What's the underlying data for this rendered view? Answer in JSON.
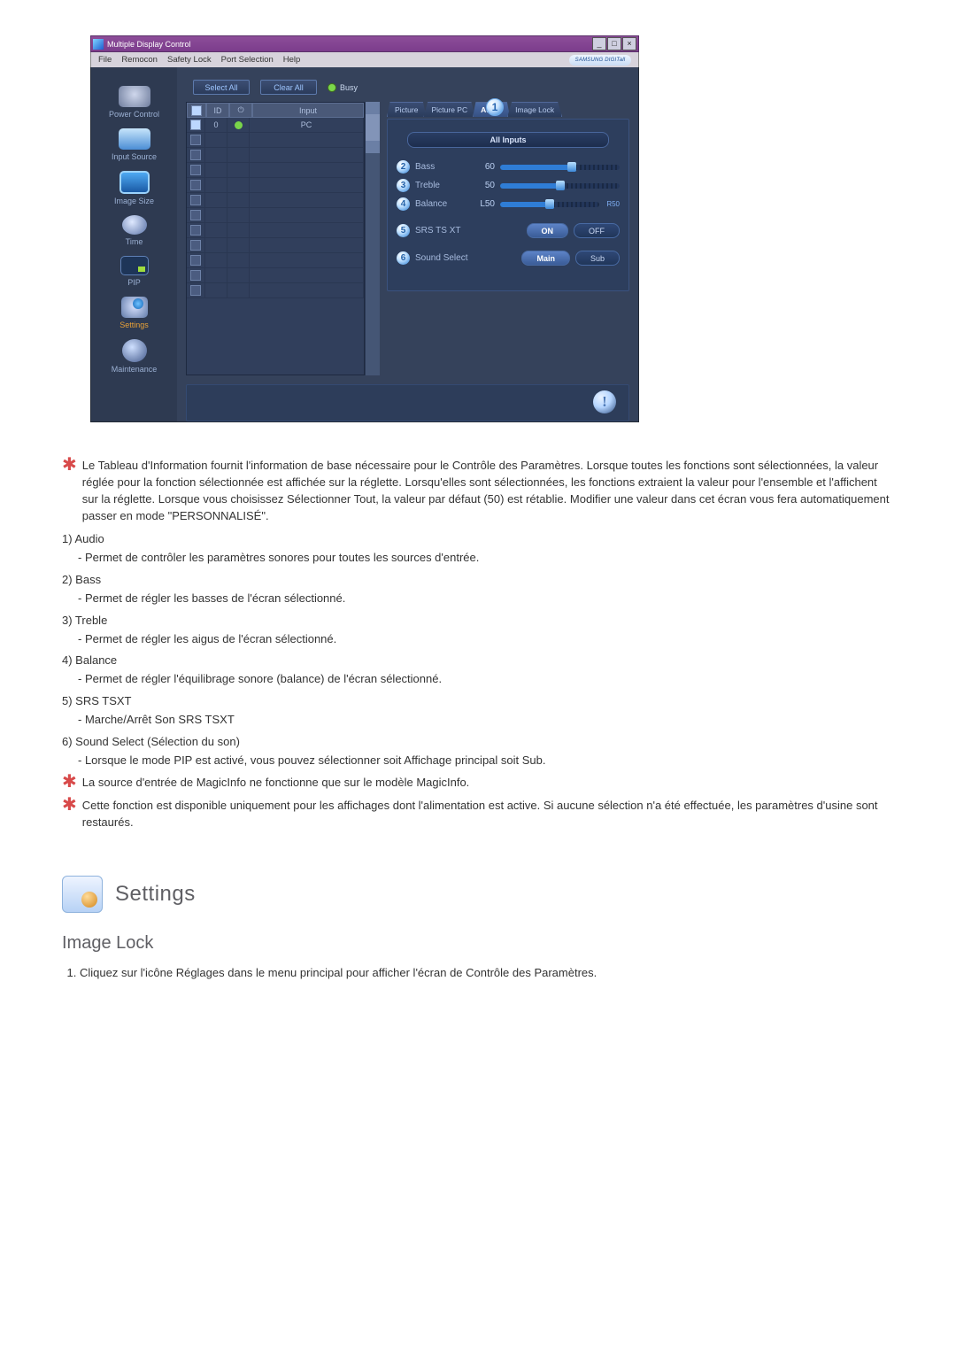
{
  "win": {
    "title": "Multiple Display Control",
    "menus": [
      "File",
      "Remocon",
      "Safety Lock",
      "Port Selection",
      "Help"
    ],
    "brand": "SAMSUNG DIGITall"
  },
  "sidebar": {
    "items": [
      {
        "label": "Power Control"
      },
      {
        "label": "Input Source"
      },
      {
        "label": "Image Size"
      },
      {
        "label": "Time"
      },
      {
        "label": "PIP"
      },
      {
        "label": "Settings"
      },
      {
        "label": "Maintenance"
      }
    ]
  },
  "top": {
    "select_all": "Select All",
    "clear_all": "Clear All",
    "busy": "Busy"
  },
  "table": {
    "headers": {
      "id": "ID",
      "input": "Input"
    },
    "first_row": {
      "id": "0",
      "input": "PC"
    }
  },
  "tabs": {
    "picture": "Picture",
    "picture_pc": "Picture PC",
    "audio": "Audio",
    "image_lock": "Image Lock",
    "badge": "1"
  },
  "panel": {
    "all_inputs": "All Inputs",
    "sliders": [
      {
        "n": "2",
        "label": "Bass",
        "val": "60",
        "pct": 60
      },
      {
        "n": "3",
        "label": "Treble",
        "val": "50",
        "pct": 50
      },
      {
        "n": "4",
        "label": "Balance",
        "val": "L50",
        "pct": 50,
        "left": "",
        "right": "R50"
      }
    ],
    "rows": [
      {
        "n": "5",
        "label": "SRS TS XT",
        "on": "ON",
        "off": "OFF"
      },
      {
        "n": "6",
        "label": "Sound Select",
        "on": "Main",
        "off": "Sub"
      }
    ]
  },
  "doc": {
    "star1": "Le Tableau d'Information fournit l'information de base nécessaire pour le Contrôle des Paramètres. Lorsque toutes les fonctions sont sélectionnées, la valeur réglée pour la fonction sélectionnée est affichée sur la réglette. Lorsqu'elles sont sélectionnées, les fonctions extraient la valeur pour l'ensemble et l'affichent sur la réglette. Lorsque vous choisissez Sélectionner Tout, la valeur par défaut (50) est rétablie. Modifier une valeur dans cet écran vous fera automatiquement passer en mode \"PERSONNALISÉ\".",
    "items": [
      {
        "h": "1) Audio",
        "s": "- Permet de contrôler les paramètres sonores pour toutes les sources d'entrée."
      },
      {
        "h": "2) Bass",
        "s": "- Permet de régler les basses de l'écran sélectionné."
      },
      {
        "h": "3) Treble",
        "s": "- Permet de régler les aigus de l'écran sélectionné."
      },
      {
        "h": "4) Balance",
        "s": "- Permet de régler l'équilibrage sonore (balance) de l'écran sélectionné."
      },
      {
        "h": "5) SRS TSXT",
        "s": "- Marche/Arrêt Son SRS TSXT"
      },
      {
        "h": "6) Sound Select (Sélection du son)",
        "s": "- Lorsque le mode PIP est activé, vous pouvez sélectionner soit Affichage principal soit Sub."
      }
    ],
    "star2": "La source d'entrée de MagicInfo ne fonctionne que sur le modèle MagicInfo.",
    "star3": "Cette fonction est disponible uniquement pour les affichages dont l'alimentation est active. Si aucune sélection n'a été effectuée, les paramètres d'usine sont restaurés.",
    "section": "Settings",
    "h2": "Image Lock",
    "step1": "Cliquez sur l'icône Réglages dans le menu principal pour afficher l'écran de Contrôle des Paramètres."
  }
}
